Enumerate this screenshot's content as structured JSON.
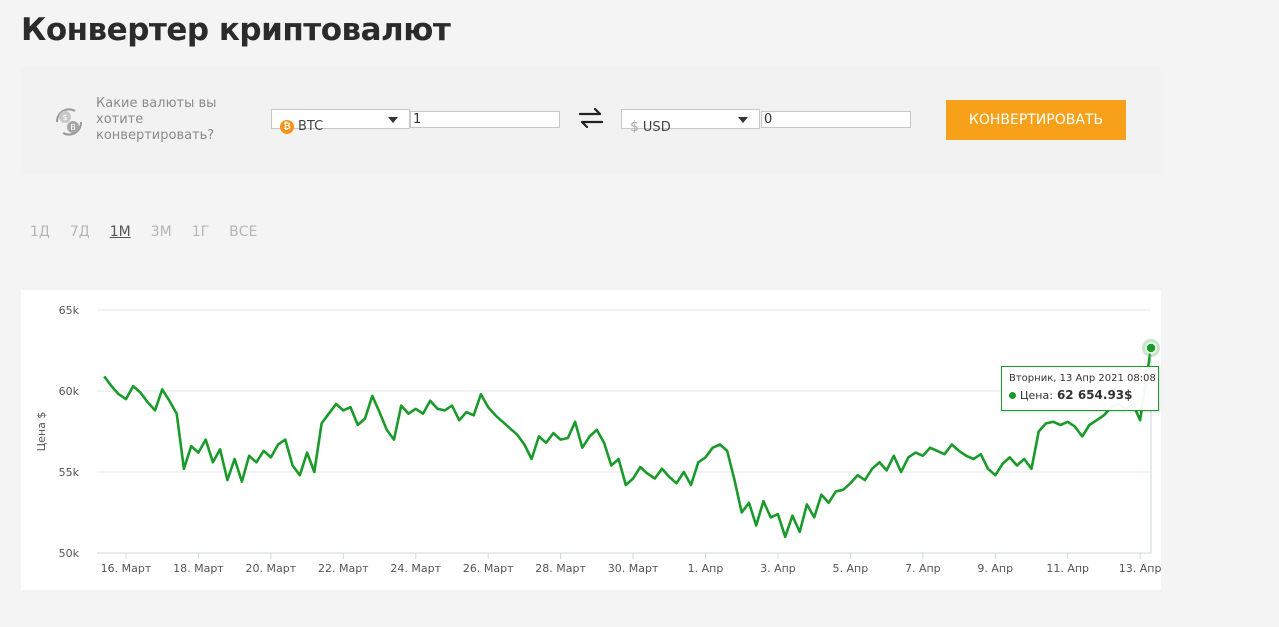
{
  "page": {
    "title": "Конвертер криптовалют"
  },
  "converter": {
    "prompt": "Какие валюты вы хотите конвертировать?",
    "from": {
      "currency": "BTC",
      "amount": "1"
    },
    "to": {
      "currency": "USD",
      "symbol": "$",
      "amount": "0"
    },
    "button_label": "КОНВЕРТИРОВАТЬ"
  },
  "ranges": {
    "items": [
      "1Д",
      "7Д",
      "1М",
      "3М",
      "1Г",
      "ВСЕ"
    ],
    "active": "1М"
  },
  "tooltip": {
    "date": "Вторник, 13 Апр 2021 08:08",
    "label": "Цена:",
    "value": "62 654.93$"
  },
  "colors": {
    "line": "#1a9a2a",
    "button": "#f7a11a",
    "btc": "#f7931a"
  },
  "chart_data": {
    "type": "line",
    "ylabel": "Цена $",
    "y_ticks": [
      "50k",
      "55k",
      "60k",
      "65k"
    ],
    "ylim": [
      50000,
      65000
    ],
    "x_tick_labels": [
      "16. Март",
      "18. Март",
      "20. Март",
      "22. Март",
      "24. Март",
      "26. Март",
      "28. Март",
      "30. Март",
      "1. Апр",
      "3. Апр",
      "5. Апр",
      "7. Апр",
      "9. Апр",
      "11. Апр",
      "13. Апр"
    ],
    "x_tick_days": [
      1,
      3,
      5,
      7,
      9,
      11,
      13,
      15,
      17,
      19,
      21,
      23,
      25,
      27,
      29
    ],
    "xlim_days": [
      0.2,
      29.3
    ],
    "grid": true,
    "series": [
      {
        "points": [
          [
            0.4,
            60900
          ],
          [
            0.6,
            60300
          ],
          [
            0.8,
            59800
          ],
          [
            1.0,
            59500
          ],
          [
            1.2,
            60300
          ],
          [
            1.4,
            59900
          ],
          [
            1.6,
            59300
          ],
          [
            1.8,
            58800
          ],
          [
            2.0,
            60100
          ],
          [
            2.2,
            59400
          ],
          [
            2.4,
            58600
          ],
          [
            2.6,
            55200
          ],
          [
            2.8,
            56600
          ],
          [
            3.0,
            56200
          ],
          [
            3.2,
            57000
          ],
          [
            3.4,
            55600
          ],
          [
            3.6,
            56400
          ],
          [
            3.8,
            54500
          ],
          [
            4.0,
            55800
          ],
          [
            4.2,
            54400
          ],
          [
            4.4,
            56000
          ],
          [
            4.6,
            55600
          ],
          [
            4.8,
            56300
          ],
          [
            5.0,
            55900
          ],
          [
            5.2,
            56700
          ],
          [
            5.4,
            57000
          ],
          [
            5.6,
            55400
          ],
          [
            5.8,
            54800
          ],
          [
            6.0,
            56200
          ],
          [
            6.2,
            55000
          ],
          [
            6.4,
            58000
          ],
          [
            6.6,
            58600
          ],
          [
            6.8,
            59200
          ],
          [
            7.0,
            58800
          ],
          [
            7.2,
            59000
          ],
          [
            7.4,
            57900
          ],
          [
            7.6,
            58300
          ],
          [
            7.8,
            59700
          ],
          [
            8.0,
            58700
          ],
          [
            8.2,
            57600
          ],
          [
            8.4,
            57000
          ],
          [
            8.6,
            59100
          ],
          [
            8.8,
            58600
          ],
          [
            9.0,
            58900
          ],
          [
            9.2,
            58600
          ],
          [
            9.4,
            59400
          ],
          [
            9.6,
            58900
          ],
          [
            9.8,
            58800
          ],
          [
            10.0,
            59100
          ],
          [
            10.2,
            58200
          ],
          [
            10.4,
            58700
          ],
          [
            10.6,
            58500
          ],
          [
            10.8,
            59800
          ],
          [
            11.0,
            59000
          ],
          [
            11.2,
            58500
          ],
          [
            11.4,
            58100
          ],
          [
            11.6,
            57700
          ],
          [
            11.8,
            57300
          ],
          [
            12.0,
            56700
          ],
          [
            12.2,
            55800
          ],
          [
            12.4,
            57200
          ],
          [
            12.6,
            56800
          ],
          [
            12.8,
            57400
          ],
          [
            13.0,
            57000
          ],
          [
            13.2,
            57100
          ],
          [
            13.4,
            58100
          ],
          [
            13.6,
            56500
          ],
          [
            13.8,
            57200
          ],
          [
            14.0,
            57600
          ],
          [
            14.2,
            56800
          ],
          [
            14.4,
            55400
          ],
          [
            14.6,
            55800
          ],
          [
            14.8,
            54200
          ],
          [
            15.0,
            54600
          ],
          [
            15.2,
            55300
          ],
          [
            15.4,
            54900
          ],
          [
            15.6,
            54600
          ],
          [
            15.8,
            55200
          ],
          [
            16.0,
            54700
          ],
          [
            16.2,
            54300
          ],
          [
            16.4,
            55000
          ],
          [
            16.6,
            54200
          ],
          [
            16.8,
            55600
          ],
          [
            17.0,
            55900
          ],
          [
            17.2,
            56500
          ],
          [
            17.4,
            56700
          ],
          [
            17.6,
            56300
          ],
          [
            17.8,
            54500
          ],
          [
            18.0,
            52500
          ],
          [
            18.2,
            53100
          ],
          [
            18.4,
            51700
          ],
          [
            18.6,
            53200
          ],
          [
            18.8,
            52200
          ],
          [
            19.0,
            52400
          ],
          [
            19.2,
            51000
          ],
          [
            19.4,
            52300
          ],
          [
            19.6,
            51300
          ],
          [
            19.8,
            53000
          ],
          [
            20.0,
            52200
          ],
          [
            20.2,
            53600
          ],
          [
            20.4,
            53100
          ],
          [
            20.6,
            53800
          ],
          [
            20.8,
            53900
          ],
          [
            21.0,
            54300
          ],
          [
            21.2,
            54800
          ],
          [
            21.4,
            54500
          ],
          [
            21.6,
            55200
          ],
          [
            21.8,
            55600
          ],
          [
            22.0,
            55100
          ],
          [
            22.2,
            56000
          ],
          [
            22.4,
            55000
          ],
          [
            22.6,
            55900
          ],
          [
            22.8,
            56200
          ],
          [
            23.0,
            56000
          ],
          [
            23.2,
            56500
          ],
          [
            23.4,
            56300
          ],
          [
            23.6,
            56100
          ],
          [
            23.8,
            56700
          ],
          [
            24.0,
            56300
          ],
          [
            24.2,
            56000
          ],
          [
            24.4,
            55800
          ],
          [
            24.6,
            56100
          ],
          [
            24.8,
            55200
          ],
          [
            25.0,
            54800
          ],
          [
            25.2,
            55500
          ],
          [
            25.4,
            55900
          ],
          [
            25.6,
            55400
          ],
          [
            25.8,
            55800
          ],
          [
            26.0,
            55200
          ],
          [
            26.2,
            57500
          ],
          [
            26.4,
            58000
          ],
          [
            26.6,
            58100
          ],
          [
            26.8,
            57900
          ],
          [
            27.0,
            58100
          ],
          [
            27.2,
            57800
          ],
          [
            27.4,
            57200
          ],
          [
            27.6,
            57900
          ],
          [
            27.8,
            58200
          ],
          [
            28.0,
            58500
          ],
          [
            28.2,
            59000
          ],
          [
            28.4,
            59200
          ],
          [
            28.6,
            58900
          ],
          [
            28.8,
            59200
          ],
          [
            29.0,
            58200
          ],
          [
            29.3,
            62655
          ]
        ]
      }
    ]
  }
}
